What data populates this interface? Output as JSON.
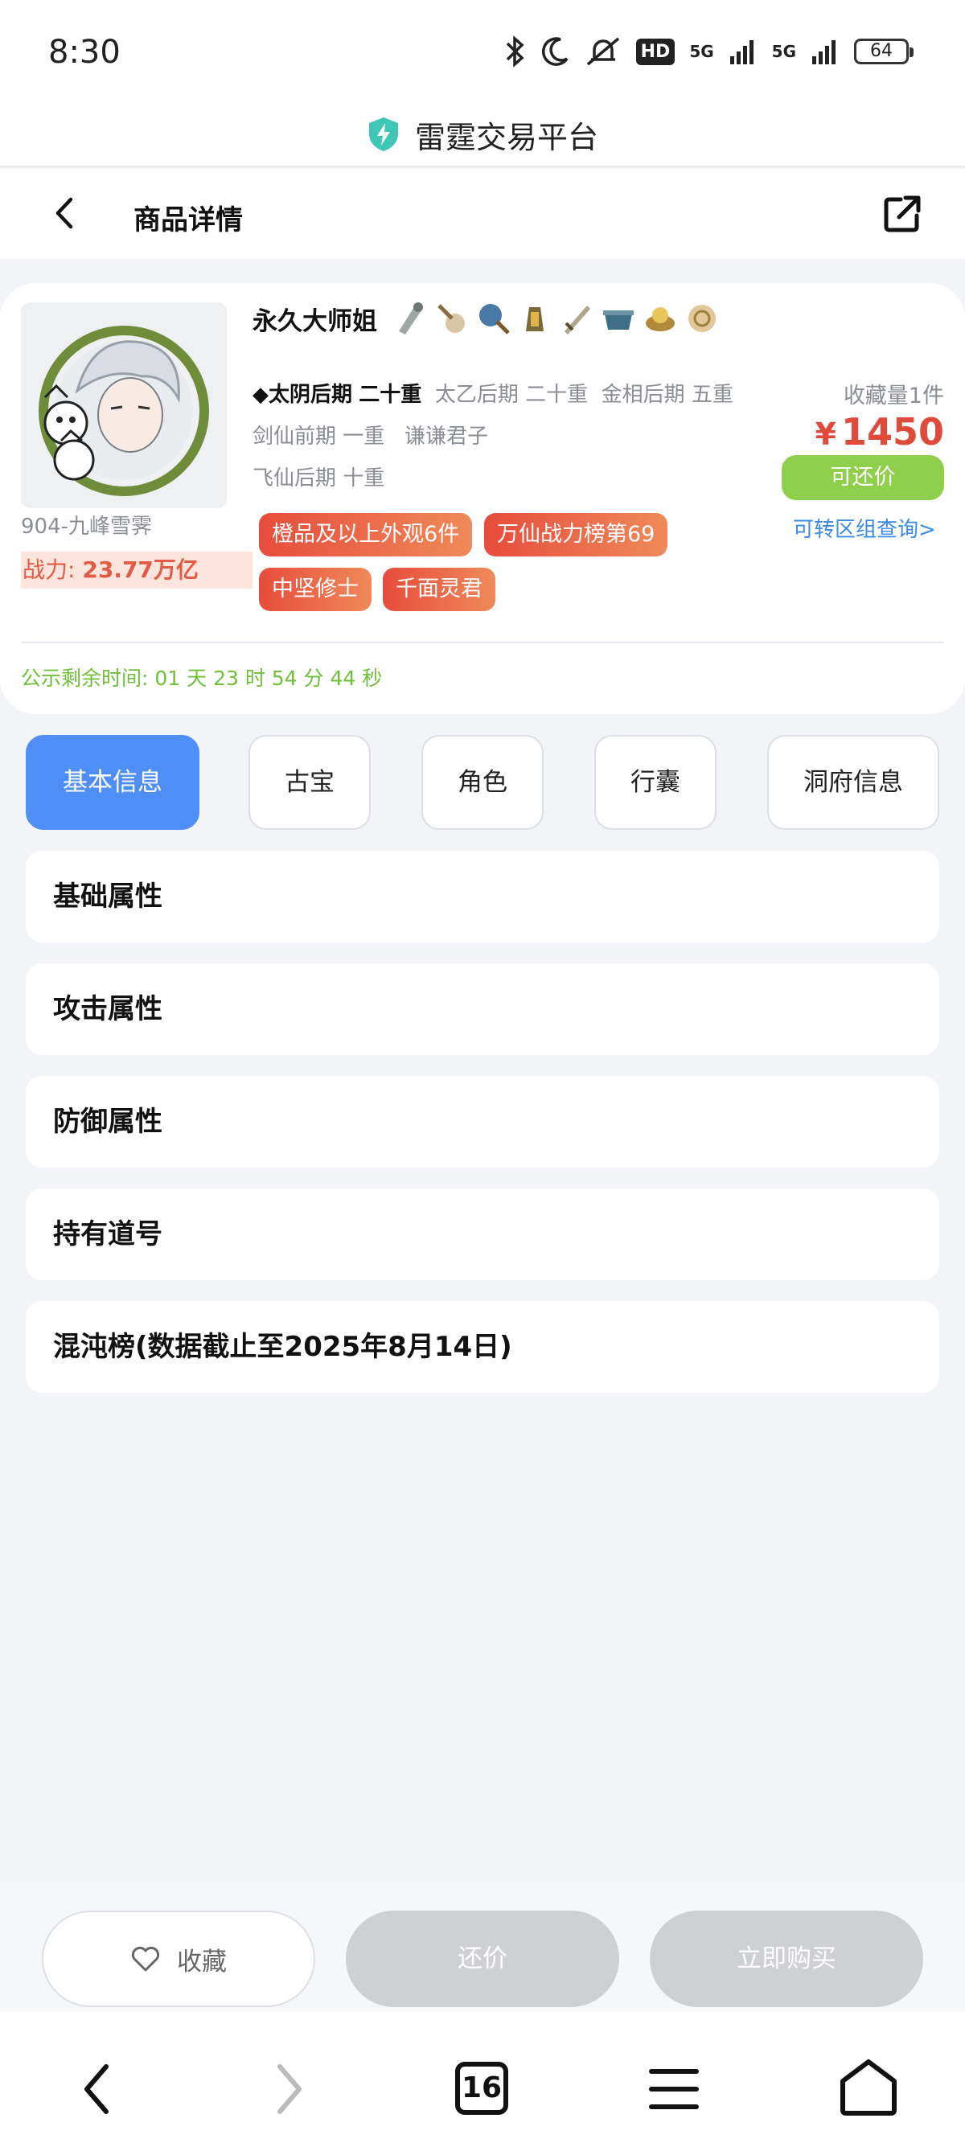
{
  "status_bar": {
    "time": "8:30",
    "hd_label": "HD",
    "net1": "5G",
    "net2": "5G",
    "battery": "64"
  },
  "site": {
    "title": "雷霆交易平台"
  },
  "navbar": {
    "title": "商品详情"
  },
  "product": {
    "name": "永久大师姐",
    "server": "904-九峰雪霁",
    "power_label": "战力: ",
    "power_value": "23.77万亿",
    "stats_line1": {
      "s1_label": "◆太阴后期",
      "s1_value": "二十重",
      "s2": "太乙后期 二十重",
      "s3": "金相后期 五重"
    },
    "stats_line2": "剑仙前期 一重   谦谦君子",
    "stats_line3": "飞仙后期 十重",
    "fav_count": "收藏量1件",
    "price_symbol": "¥",
    "price": "1450",
    "bargain_label": "可还价",
    "transfer_link": "可转区组查询>",
    "tags": [
      "橙品及以上外观6件",
      "万仙战力榜第69",
      "中坚修士",
      "千面灵君"
    ],
    "countdown": "公示剩余时间: 01 天 23 时 54 分 44 秒"
  },
  "tabs": [
    "基本信息",
    "古宝",
    "角色",
    "行囊",
    "洞府信息"
  ],
  "sections": [
    "基础属性",
    "攻击属性",
    "防御属性",
    "持有道号",
    "混沌榜(数据截止至2025年8月14日)"
  ],
  "actions": {
    "favorite": "收藏",
    "bargain": "还价",
    "buy_now": "立即购买"
  },
  "system_nav": {
    "tab_count": "16"
  },
  "colors": {
    "accent_blue": "#4f8ef7",
    "price_red": "#e04a3a",
    "bargain_green": "#8ed04c",
    "countdown_green": "#6fbf3a"
  }
}
